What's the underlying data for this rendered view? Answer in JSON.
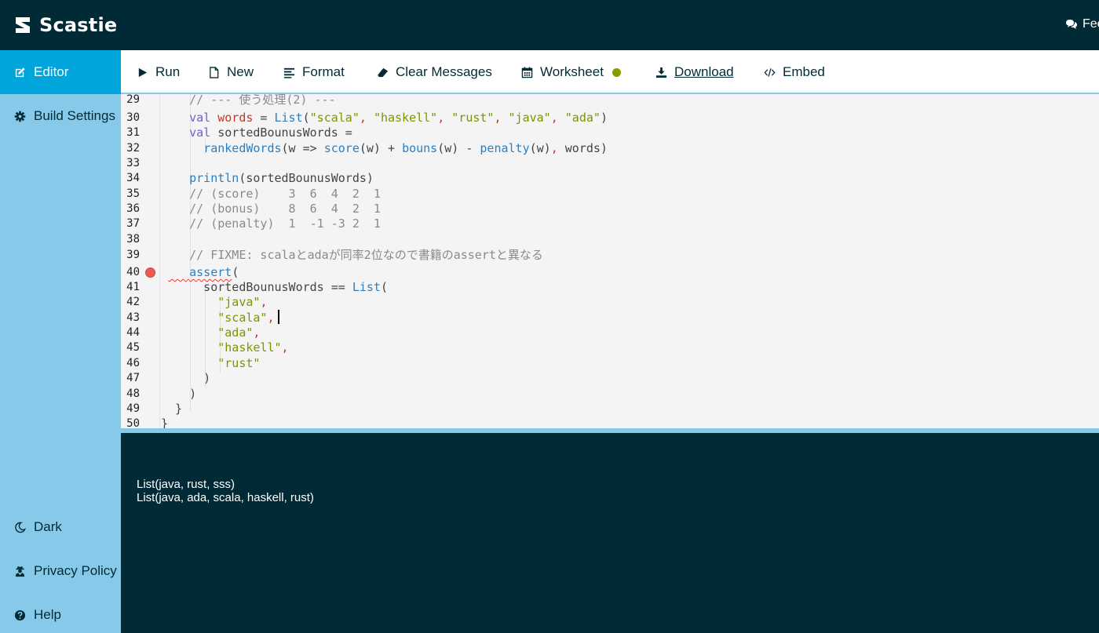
{
  "app": {
    "name": "Scastie",
    "feedback_label": "Fee"
  },
  "sidebar": {
    "items": [
      {
        "label": "Editor",
        "icon": "edit-icon",
        "active": true
      },
      {
        "label": "Build Settings",
        "icon": "gear-icon"
      },
      {
        "label": "Dark",
        "icon": "moon-icon"
      },
      {
        "label": "Privacy Policy",
        "icon": "user-secret-icon"
      },
      {
        "label": "Help",
        "icon": "question-circle-icon"
      }
    ]
  },
  "toolbar": {
    "run": "Run",
    "new": "New",
    "format": "Format",
    "clear_messages": "Clear Messages",
    "worksheet": "Worksheet",
    "download": "Download",
    "embed": "Embed",
    "worksheet_indicator_color": "#8a9a00"
  },
  "editor": {
    "line_numbers": [
      "29",
      "30",
      "31",
      "32",
      "33",
      "34",
      "35",
      "36",
      "37",
      "38",
      "39",
      "40",
      "41",
      "42",
      "43",
      "44",
      "45",
      "46",
      "47",
      "48",
      "49",
      "50"
    ],
    "error_line": "40",
    "lines": [
      {
        "t": "    // --- 使う処理(2) ---"
      },
      {
        "t": "    val words = List(\"scala\", \"haskell\", \"rust\", \"java\", \"ada\")"
      },
      {
        "t": "    val sortedBounusWords ="
      },
      {
        "t": "      rankedWords(w => score(w) + bouns(w) - penalty(w), words)"
      },
      {
        "t": ""
      },
      {
        "t": "    println(sortedBounusWords)"
      },
      {
        "t": "    // (score)    3  6  4  2  1"
      },
      {
        "t": "    // (bonus)    8  6  4  2  1"
      },
      {
        "t": "    // (penalty)  1  -1 -3 2  1"
      },
      {
        "t": ""
      },
      {
        "t": "    // FIXME: scalaとadaが同率2位なので書籍のassertと異なる"
      },
      {
        "t": "    assert("
      },
      {
        "t": "      sortedBounusWords == List("
      },
      {
        "t": "        \"java\","
      },
      {
        "t": "        \"scala\","
      },
      {
        "t": "        \"ada\","
      },
      {
        "t": "        \"haskell\","
      },
      {
        "t": "        \"rust\""
      },
      {
        "t": "      )"
      },
      {
        "t": "    )"
      },
      {
        "t": "  }"
      },
      {
        "t": "}"
      }
    ]
  },
  "console": {
    "lines": [
      "List(java, rust, sss)",
      "List(java, ada, scala, haskell, rust)"
    ]
  }
}
